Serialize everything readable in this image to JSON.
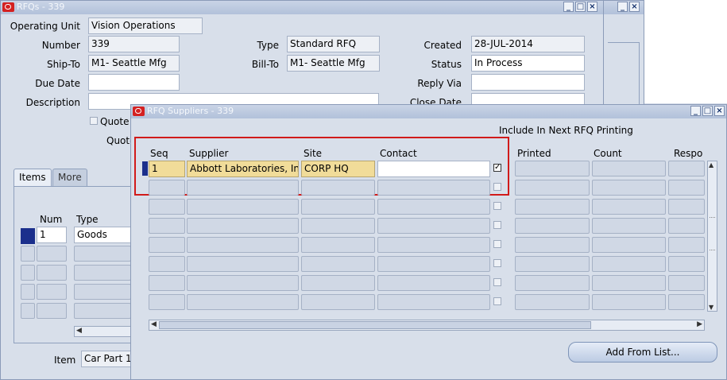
{
  "rfq_window": {
    "title": "RFQs - 339",
    "labels": {
      "operating_unit": "Operating Unit",
      "number": "Number",
      "ship_to": "Ship-To",
      "due_date": "Due Date",
      "description": "Description",
      "type": "Type",
      "bill_to": "Bill-To",
      "created": "Created",
      "status": "Status",
      "reply_via": "Reply Via",
      "close_date": "Close Date",
      "quote_chk": "Quote",
      "quote2": "Quote"
    },
    "values": {
      "operating_unit": "Vision Operations",
      "number": "339",
      "ship_to": "M1- Seattle Mfg",
      "due_date": "",
      "description": "",
      "type": "Standard RFQ",
      "bill_to": "M1- Seattle Mfg",
      "created": "28-JUL-2014",
      "status": "In Process",
      "reply_via": "",
      "close_date": ""
    },
    "tabs": [
      "Items",
      "More"
    ],
    "lines_headers": {
      "num": "Num",
      "type": "Type"
    },
    "lines": [
      {
        "num": "1",
        "type": "Goods"
      }
    ],
    "item_label": "Item",
    "item_value": "Car Part 1"
  },
  "suppliers_window": {
    "title": "RFQ Suppliers - 339",
    "group_header": "Include In Next RFQ Printing",
    "headers": {
      "seq": "Seq",
      "supplier": "Supplier",
      "site": "Site",
      "contact": "Contact",
      "printed": "Printed",
      "count": "Count",
      "response": "Respo"
    },
    "rows": [
      {
        "seq": "1",
        "supplier": "Abbott Laboratories, Inc",
        "site": "CORP HQ",
        "contact": "",
        "include": true
      }
    ],
    "add_from_list": "Add From List...",
    "highlight_color": "#d11a1a"
  }
}
